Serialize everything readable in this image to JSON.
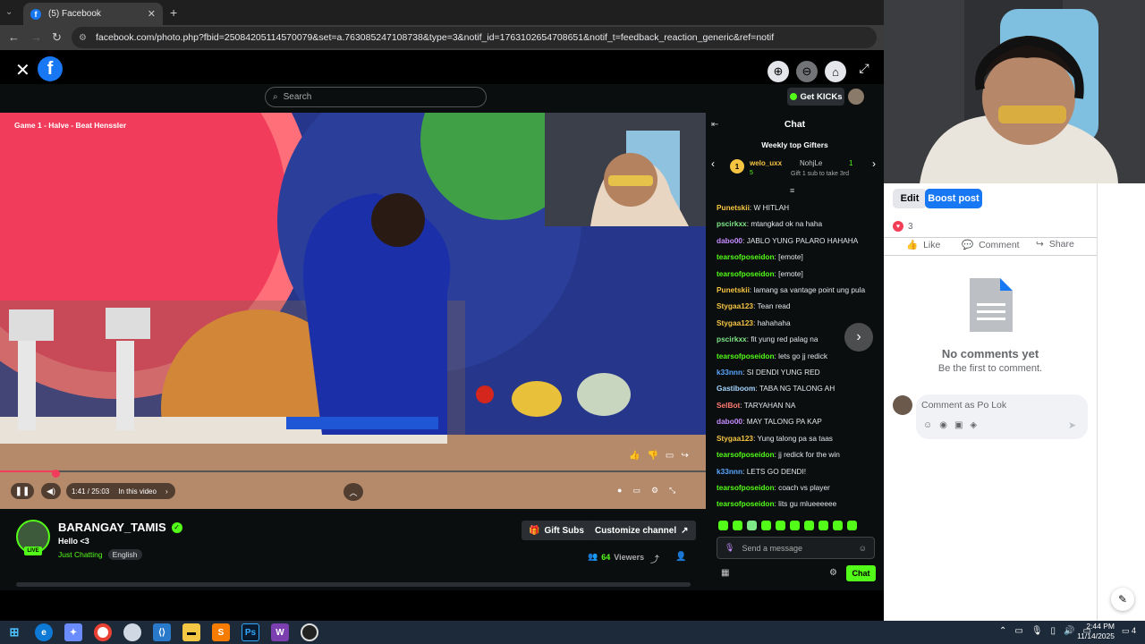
{
  "browser": {
    "tab_title": "(5) Facebook",
    "url": "facebook.com/photo.php?fbid=2508420511457007​9&set=a.763085247108738&type=3&notif_id=1763102654708651&notif_t=feedback_reaction_generic&ref=notif"
  },
  "kick": {
    "search_placeholder": "Search",
    "get_kicks": "Get KICKs",
    "video_overlay": "Game 1 - Halve - Beat Henssler",
    "time": "1:41 / 25:03",
    "in_this_video": "In this video",
    "channel_name": "BARANGAY_TAMIS",
    "stream_title": "Hello <3",
    "category": "Just Chatting",
    "language": "English",
    "live_badge": "LIVE",
    "gift_subs": "Gift Subs",
    "customize_channel": "Customize channel",
    "viewers_count": "64",
    "viewers_label": "Viewers",
    "chat_title": "Chat",
    "weekly_top_gifters": "Weekly top Gifters",
    "gifters": [
      {
        "rank": "1",
        "name": "welo_uxx",
        "count": "5"
      },
      {
        "name": "NohjLe",
        "count": "1",
        "hint": "Gift 1 sub to take 3rd"
      }
    ],
    "messages": [
      {
        "user": "Punetskii",
        "color": "#f5c542",
        "text": "W HITLAH"
      },
      {
        "user": "pscirkxx",
        "color": "#7ee787",
        "text": "mtangkad ok na haha"
      },
      {
        "user": "dabo00",
        "color": "#c58cff",
        "text": "JABLO YUNG PALARO HAHAHA"
      },
      {
        "user": "tearsofposeidon",
        "color": "#53fc18",
        "text": "[emote]"
      },
      {
        "user": "tearsofposeidon",
        "color": "#53fc18",
        "text": "[emote]"
      },
      {
        "user": "Punetskii",
        "color": "#f5c542",
        "text": "lamang sa vantage point ung pula"
      },
      {
        "user": "Stygaa123",
        "color": "#f5c542",
        "text": "Tean read"
      },
      {
        "user": "Stygaa123",
        "color": "#f5c542",
        "text": "hahahaha"
      },
      {
        "user": "pscirkxx",
        "color": "#7ee787",
        "text": "fit yung red palag na"
      },
      {
        "user": "tearsofposeidon",
        "color": "#53fc18",
        "text": "lets go jj redick"
      },
      {
        "user": "k33nnn",
        "color": "#58a6ff",
        "text": "SI DENDI YUNG RED"
      },
      {
        "user": "Gastiboom",
        "color": "#a5d6ff",
        "text": "TABA NG TALONG AH"
      },
      {
        "user": "SelBot",
        "color": "#ff7b72",
        "text": "TARYAHAN NA"
      },
      {
        "user": "dabo00",
        "color": "#c58cff",
        "text": "MAY TALONG PA KAP"
      },
      {
        "user": "Stygaa123",
        "color": "#f5c542",
        "text": "Yung talong pa sa taas"
      },
      {
        "user": "tearsofposeidon",
        "color": "#53fc18",
        "text": "jj redick for the win"
      },
      {
        "user": "k33nnn",
        "color": "#58a6ff",
        "text": "LETS GO DENDI!"
      },
      {
        "user": "tearsofposeidon",
        "color": "#53fc18",
        "text": "coach vs player"
      },
      {
        "user": "tearsofposeidon",
        "color": "#53fc18",
        "text": "lits gu mlueeeeee"
      }
    ],
    "send_placeholder": "Send a message",
    "chat_button": "Chat",
    "progress": 0.08
  },
  "facebook": {
    "edit": "Edit",
    "boost_post": "Boost post",
    "reactions_count": "3",
    "like": "Like",
    "comment": "Comment",
    "share": "Share",
    "no_comments": "No comments yet",
    "be_first": "Be the first to comment.",
    "comment_placeholder": "Comment as Po Lok"
  },
  "taskbar": {
    "time": "2:44 PM",
    "date": "11/14/2025",
    "notification_count": "4"
  },
  "colors": {
    "kick_green": "#53fc18",
    "fb_blue": "#1877f2",
    "chrome_dark": "#1f1f1f"
  }
}
